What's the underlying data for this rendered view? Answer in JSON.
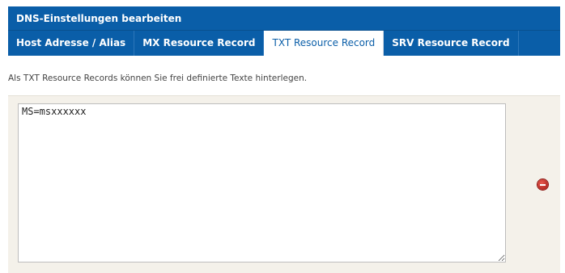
{
  "header": {
    "title": "DNS-Einstellungen bearbeiten"
  },
  "tabs": [
    {
      "label": "Host Adresse / Alias",
      "active": false
    },
    {
      "label": "MX Resource Record",
      "active": false
    },
    {
      "label": "TXT Resource Record",
      "active": true
    },
    {
      "label": "SRV Resource Record",
      "active": false
    }
  ],
  "content": {
    "description": "Als TXT Resource Records können Sie frei definierte Texte hinterlegen.",
    "txt_value": "MS=msxxxxxx"
  },
  "icons": {
    "remove": "remove-circle-icon"
  },
  "colors": {
    "header_bg": "#0a5ea8",
    "remove_red": "#c62219"
  }
}
